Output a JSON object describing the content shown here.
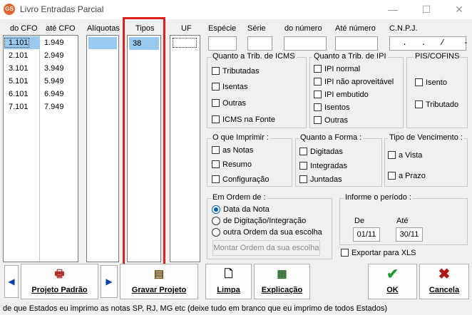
{
  "window": {
    "title": "Livro Entradas Parcial",
    "app_icon_text": "GS"
  },
  "cfo_list": {
    "header_from": "do CFO",
    "header_to": "até CFO",
    "rows": [
      {
        "from": "1.101",
        "to": "1.949"
      },
      {
        "from": "2.101",
        "to": "2.949"
      },
      {
        "from": "3.101",
        "to": "3.949"
      },
      {
        "from": "5.101",
        "to": "5.949"
      },
      {
        "from": "6.101",
        "to": "6.949"
      },
      {
        "from": "7.101",
        "to": "7.949"
      }
    ]
  },
  "aliquotas": {
    "header": "Alíquotas"
  },
  "tipos": {
    "header": "Tipos",
    "items": [
      "38"
    ]
  },
  "uf": {
    "header": "UF"
  },
  "fields": {
    "especie": {
      "label": "Espécie",
      "value": ""
    },
    "serie": {
      "label": "Série",
      "value": ""
    },
    "do_numero": {
      "label": "do número",
      "value": ""
    },
    "ate_numero": {
      "label": "Até número",
      "value": ""
    },
    "cnpj": {
      "label": "C.N.P.J.",
      "value": "  .   .   /    -  "
    }
  },
  "icms_group": {
    "title": "Quanto a Trib. de ICMS",
    "options": [
      "Tributadas",
      "Isentas",
      "Outras",
      "ICMS na Fonte"
    ]
  },
  "ipi_group": {
    "title": "Quanto a Trib. de IPI",
    "options": [
      "IPI normal",
      "IPI não aproveitável",
      "IPI embutido",
      "Isentos",
      "Outras"
    ]
  },
  "pis_group": {
    "title": "PIS/COFINS",
    "options": [
      "Isento",
      "Tributado"
    ]
  },
  "imprimir_group": {
    "title": "O que Imprimir :",
    "options": [
      "as Notas",
      "Resumo",
      "Configuração"
    ]
  },
  "forma_group": {
    "title": "Quanto a Forma :",
    "options": [
      "Digitadas",
      "Integradas",
      "Juntadas"
    ]
  },
  "vencimento_group": {
    "title": "Tipo de Vencimento :",
    "options": [
      "a Vista",
      "a Prazo"
    ]
  },
  "ordem_group": {
    "title": "Em Ordem de :",
    "options": [
      "Data da Nota",
      "de Digitação/Integração",
      "outra Ordem da sua escolha"
    ],
    "selected": "Data da Nota",
    "button": "Montar Ordem da sua escolha"
  },
  "periodo_group": {
    "title": "Informe o período :",
    "de_label": "De",
    "ate_label": "Até",
    "de_value": "01/11",
    "ate_value": "30/11"
  },
  "exportar": {
    "label": "Exportar para XLS",
    "checked": false
  },
  "buttons": {
    "projeto_padrao": "Projeto Padrão",
    "gravar_projeto": "Gravar Projeto",
    "limpa": "Limpa",
    "explicacao": "Explicação",
    "ok": "OK",
    "cancela": "Cancela"
  },
  "status": "de que Estados eu imprimo as notas SP, RJ, MG etc (deixe tudo em branco que eu imprimo de todos Estados)"
}
